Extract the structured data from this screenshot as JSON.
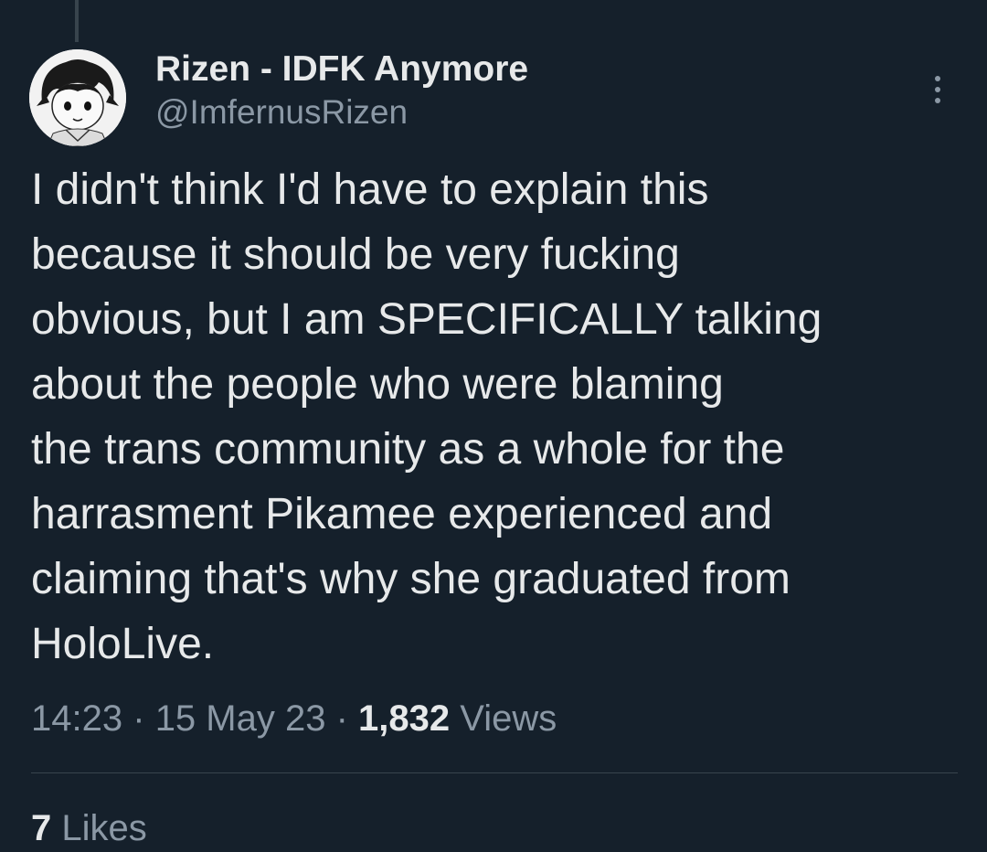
{
  "tweet": {
    "author": {
      "display_name": "Rizen - IDFK Anymore",
      "handle": "@ImfernusRizen",
      "avatar_icon": "anime-avatar-icon"
    },
    "more_icon": "more-options-icon",
    "text": "I didn't think I'd have to explain this\nbecause it should be very fucking\nobvious, but I am SPECIFICALLY talking\nabout the people who were blaming\nthe trans community as a whole for the\nharrasment Pikamee experienced and\nclaiming that's why she graduated from\nHoloLive.",
    "meta": {
      "time": "14:23",
      "separator": "·",
      "date": "15 May 23",
      "views_count": "1,832",
      "views_label": "Views"
    },
    "stats": {
      "likes_count": "7",
      "likes_label": "Likes"
    }
  },
  "colors": {
    "background": "#15202b",
    "primary_text": "#e7e9ea",
    "secondary_text": "#8b98a5",
    "divider": "#38444d"
  }
}
